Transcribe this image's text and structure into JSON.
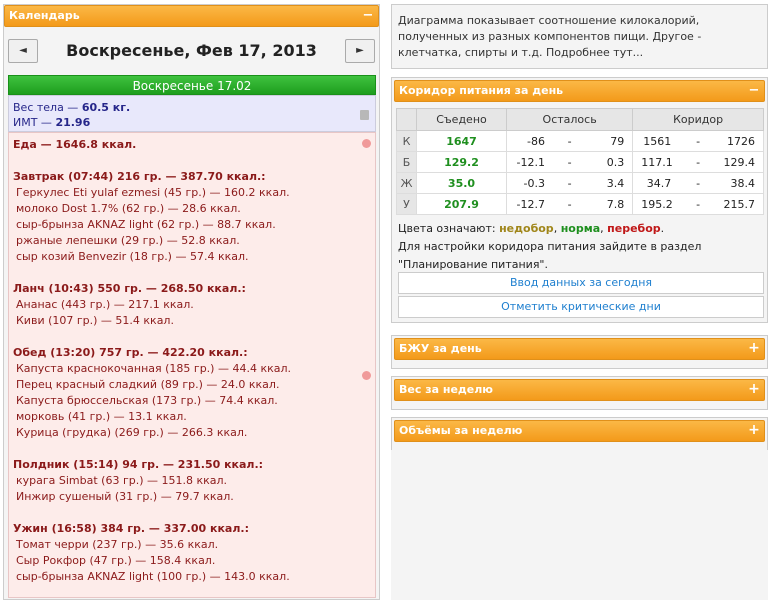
{
  "calendar": {
    "header": "Календарь",
    "toggle": "−",
    "prev": "◄",
    "next": "►",
    "title": "Воскресенье, Фев 17, 2013"
  },
  "day": {
    "bar": "Воскресенье 17.02",
    "weight_label": "Вес тела — ",
    "weight_value": "60.5 кг.",
    "bmi_label": "ИМТ — ",
    "bmi_value": "21.96",
    "food_total": "Еда — 1646.8 ккал.",
    "meals": [
      {
        "title": "Завтрак (07:44) 216 гр. — 387.70 ккал.:",
        "items": [
          "Геркулес Eti yulaf ezmesi (45 гр.) — 160.2 ккал.",
          "молоко Dost 1.7% (62 гр.) — 28.6 ккал.",
          "сыр-брынза AKNAZ light (62 гр.) — 88.7 ккал.",
          "ржаные лепешки (29 гр.) — 52.8 ккал.",
          "сыр козий Benvezir (18 гр.) — 57.4 ккал."
        ]
      },
      {
        "title": "Ланч (10:43) 550 гр. — 268.50 ккал.:",
        "items": [
          "Ананас (443 гр.) — 217.1 ккал.",
          "Киви (107 гр.) — 51.4 ккал."
        ]
      },
      {
        "title": "Обед (13:20) 757 гр. — 422.20 ккал.:",
        "items": [
          "Капуста краснокочанная (185 гр.) — 44.4 ккал.",
          "Перец красный сладкий (89 гр.) — 24.0 ккал.",
          "Капуста брюссельская (173 гр.) — 74.4 ккал.",
          "морковь (41 гр.) — 13.1 ккал.",
          "Курица (грудка) (269 гр.) — 266.3 ккал."
        ]
      },
      {
        "title": "Полдник (15:14) 94 гр. — 231.50 ккал.:",
        "items": [
          "курага Simbat (63 гр.) — 151.8 ккал.",
          "Инжир сушеный (31 гр.) — 79.7 ккал."
        ]
      },
      {
        "title": "Ужин (16:58) 384 гр. — 337.00 ккал.:",
        "items": [
          "Томат черри (237 гр.) — 35.6 ккал.",
          "Сыр Рокфор (47 гр.) — 158.4 ккал.",
          "сыр-брынза AKNAZ light (100 гр.) — 143.0 ккал."
        ]
      }
    ]
  },
  "description": "Диаграмма показывает соотношение килокалорий, полученных из разных компонентов пищи. Другое - клетчатка, спирты и т.д. Подробнее тут...",
  "corridor": {
    "header": "Коридор питания за день",
    "toggle": "−",
    "columns": [
      "",
      "Съедено",
      "Осталось",
      "Коридор"
    ],
    "rows": [
      {
        "label": "К",
        "eaten": "1647",
        "left_min": "-86",
        "left_max": "79",
        "corr_min": "1561",
        "corr_max": "1726"
      },
      {
        "label": "Б",
        "eaten": "129.2",
        "left_min": "-12.1",
        "left_max": "0.3",
        "corr_min": "117.1",
        "corr_max": "129.4"
      },
      {
        "label": "Ж",
        "eaten": "35.0",
        "left_min": "-0.3",
        "left_max": "3.4",
        "corr_min": "34.7",
        "corr_max": "38.4"
      },
      {
        "label": "У",
        "eaten": "207.9",
        "left_min": "-12.7",
        "left_max": "7.8",
        "corr_min": "195.2",
        "corr_max": "215.7"
      }
    ],
    "dash": "-",
    "legend_prefix": "Цвета означают: ",
    "under": "недобор",
    "norm": "норма",
    "over": "перебор",
    "setup_text": "Для настройки коридора питания зайдите в раздел \"Планирование питания\".",
    "btn_today": "Ввод данных за сегодня",
    "btn_critical": "Отметить критические дни"
  },
  "panels": {
    "bju": "БЖУ за день",
    "weight": "Вес за неделю",
    "volumes": "Объёмы за неделю",
    "plus": "+"
  }
}
